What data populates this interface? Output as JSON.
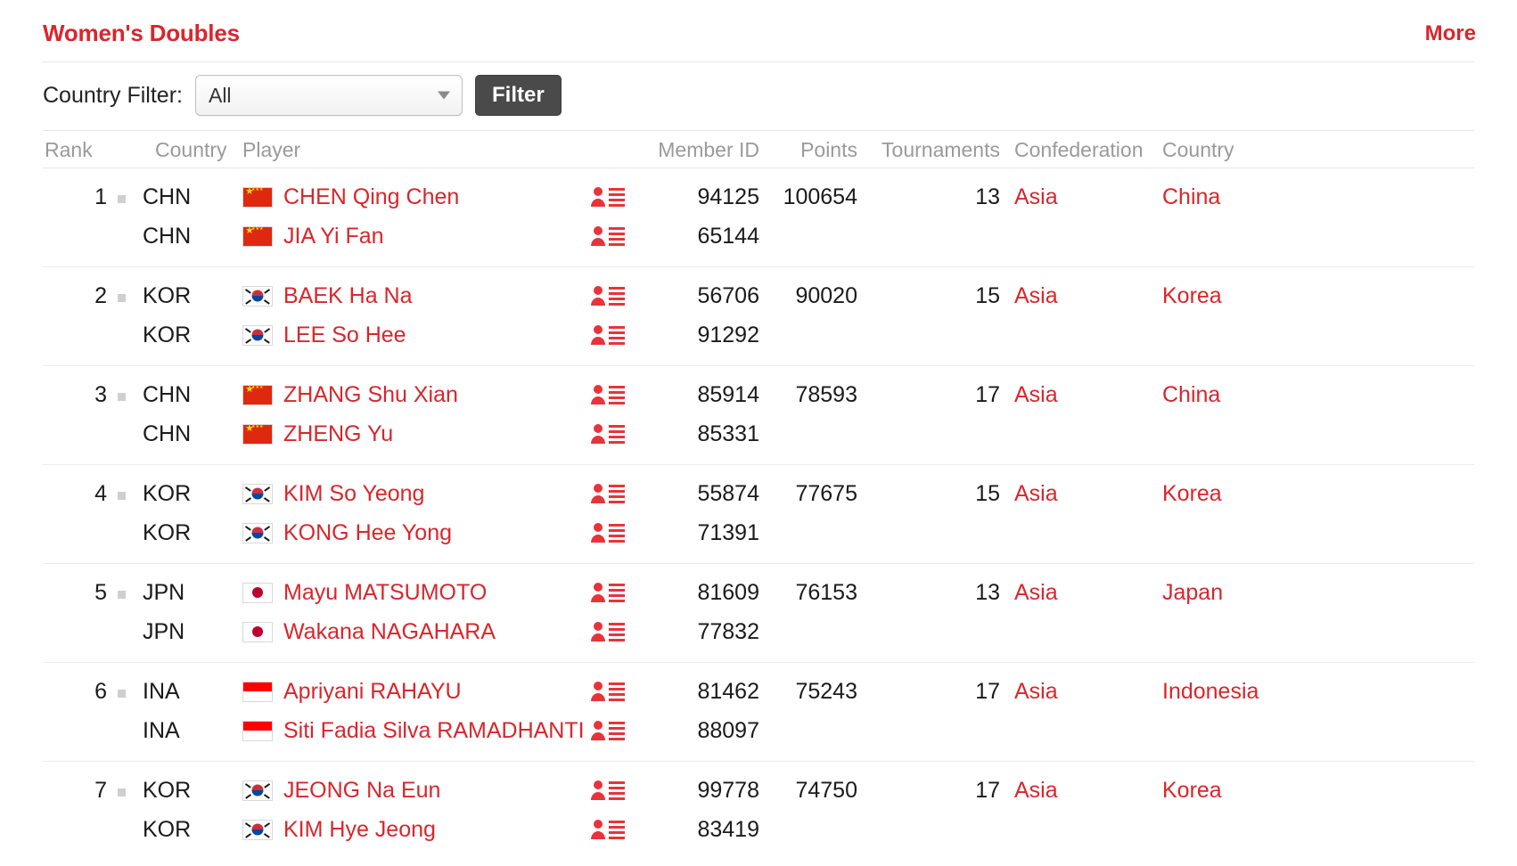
{
  "header": {
    "title": "Women's Doubles",
    "more_label": "More"
  },
  "filter": {
    "label": "Country Filter:",
    "selected": "All",
    "options": [
      "All"
    ],
    "button_label": "Filter",
    "caret_icon": "chevron-down-icon"
  },
  "table": {
    "columns": [
      "Rank",
      "Country",
      "Player",
      "Member ID",
      "Points",
      "Tournaments",
      "Confederation",
      "Country"
    ],
    "rows": [
      {
        "rank": "1",
        "points": "100654",
        "tournaments": "13",
        "confederation": "Asia",
        "country": "China",
        "players": [
          {
            "code": "CHN",
            "flag": "chn",
            "name": "CHEN Qing Chen",
            "member_id": "94125"
          },
          {
            "code": "CHN",
            "flag": "chn",
            "name": "JIA Yi Fan",
            "member_id": "65144"
          }
        ]
      },
      {
        "rank": "2",
        "points": "90020",
        "tournaments": "15",
        "confederation": "Asia",
        "country": "Korea",
        "players": [
          {
            "code": "KOR",
            "flag": "kor",
            "name": "BAEK Ha Na",
            "member_id": "56706"
          },
          {
            "code": "KOR",
            "flag": "kor",
            "name": "LEE So Hee",
            "member_id": "91292"
          }
        ]
      },
      {
        "rank": "3",
        "points": "78593",
        "tournaments": "17",
        "confederation": "Asia",
        "country": "China",
        "players": [
          {
            "code": "CHN",
            "flag": "chn",
            "name": "ZHANG Shu Xian",
            "member_id": "85914"
          },
          {
            "code": "CHN",
            "flag": "chn",
            "name": "ZHENG Yu",
            "member_id": "85331"
          }
        ]
      },
      {
        "rank": "4",
        "points": "77675",
        "tournaments": "15",
        "confederation": "Asia",
        "country": "Korea",
        "players": [
          {
            "code": "KOR",
            "flag": "kor",
            "name": "KIM So Yeong",
            "member_id": "55874"
          },
          {
            "code": "KOR",
            "flag": "kor",
            "name": "KONG Hee Yong",
            "member_id": "71391"
          }
        ]
      },
      {
        "rank": "5",
        "points": "76153",
        "tournaments": "13",
        "confederation": "Asia",
        "country": "Japan",
        "players": [
          {
            "code": "JPN",
            "flag": "jpn",
            "name": "Mayu MATSUMOTO",
            "member_id": "81609"
          },
          {
            "code": "JPN",
            "flag": "jpn",
            "name": "Wakana NAGAHARA",
            "member_id": "77832"
          }
        ]
      },
      {
        "rank": "6",
        "points": "75243",
        "tournaments": "17",
        "confederation": "Asia",
        "country": "Indonesia",
        "players": [
          {
            "code": "INA",
            "flag": "ina",
            "name": "Apriyani RAHAYU",
            "member_id": "81462"
          },
          {
            "code": "INA",
            "flag": "ina",
            "name": "Siti Fadia Silva RAMADHANTI",
            "member_id": "88097"
          }
        ]
      },
      {
        "rank": "7",
        "points": "74750",
        "tournaments": "17",
        "confederation": "Asia",
        "country": "Korea",
        "players": [
          {
            "code": "KOR",
            "flag": "kor",
            "name": "JEONG Na Eun",
            "member_id": "99778"
          },
          {
            "code": "KOR",
            "flag": "kor",
            "name": "KIM Hye Jeong",
            "member_id": "83419"
          }
        ]
      }
    ]
  },
  "icons": {
    "bio": "player-profile-icon",
    "rank_marker": "rank-change-marker"
  },
  "colors": {
    "accent_red": "#d8262c",
    "header_grey": "#9a9a9a",
    "text_dark": "#1a1a1a",
    "rule": "#e6e6e6"
  }
}
